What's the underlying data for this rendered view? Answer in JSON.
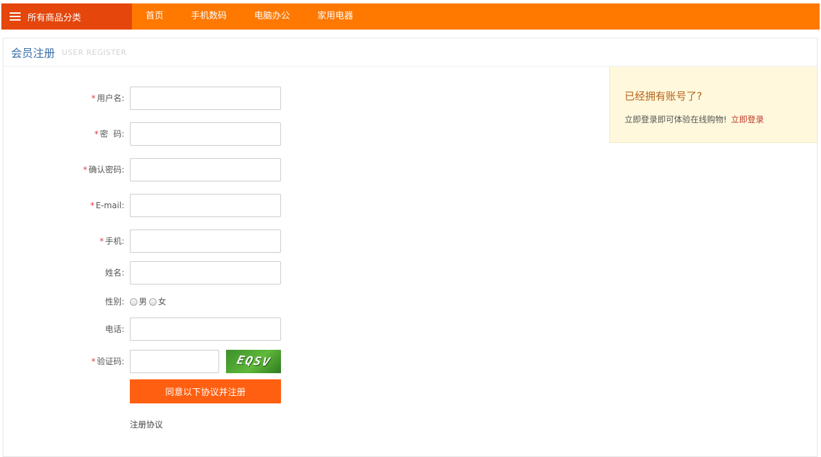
{
  "nav": {
    "all_categories": "所有商品分类",
    "links": [
      "首页",
      "手机数码",
      "电脑办公",
      "家用电器"
    ]
  },
  "panel": {
    "title": "会员注册",
    "subtitle": "USER REGISTER"
  },
  "form": {
    "required_mark": "*",
    "username_label": "用户名:",
    "password_label": "密  码:",
    "confirm_label": "确认密码:",
    "email_label": "E-mail:",
    "mobile_label": "手机:",
    "name_label": "姓名:",
    "gender_label": "性别:",
    "gender_options": [
      "男",
      "女"
    ],
    "phone_label": "电话:",
    "captcha_label": "验证码:",
    "captcha_text": "EQSV",
    "submit_label": "同意以下协议并注册",
    "agreement_link": "注册协议"
  },
  "side": {
    "question": "已经拥有账号了?",
    "description": "立即登录即可体验在线购物!",
    "login_link": "立即登录"
  },
  "colors": {
    "nav_bg": "#ff7800",
    "category_bg": "#e4460b",
    "submit_bg": "#ff5f10",
    "side_bg": "#fff8dc",
    "title_color": "#3a6ea5"
  }
}
